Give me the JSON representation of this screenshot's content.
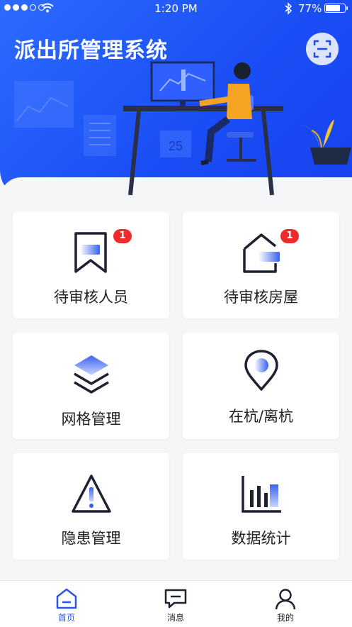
{
  "status_bar": {
    "time": "1:20 PM",
    "battery": "77%",
    "battery_level": 0.77
  },
  "header": {
    "title": "派出所管理系统",
    "scan_icon": "scan-icon"
  },
  "illustration": {
    "calendar_text": "25"
  },
  "menu": [
    {
      "label": "待审核人员",
      "icon": "bookmark-person-icon",
      "badge": "1"
    },
    {
      "label": "待审核房屋",
      "icon": "house-icon",
      "badge": "1"
    },
    {
      "label": "网格管理",
      "icon": "layers-icon"
    },
    {
      "label": "在杭/离杭",
      "icon": "location-pin-icon"
    },
    {
      "label": "隐患管理",
      "icon": "warning-icon"
    },
    {
      "label": "数据统计",
      "icon": "bar-chart-icon"
    }
  ],
  "tabbar": [
    {
      "label": "首页",
      "icon": "home-icon",
      "active": true
    },
    {
      "label": "消息",
      "icon": "message-icon"
    },
    {
      "label": "我的",
      "icon": "profile-icon"
    }
  ],
  "colors": {
    "primary": "#1a4df5",
    "badge": "#ee2a2a",
    "active_tab": "#2a55e8"
  }
}
